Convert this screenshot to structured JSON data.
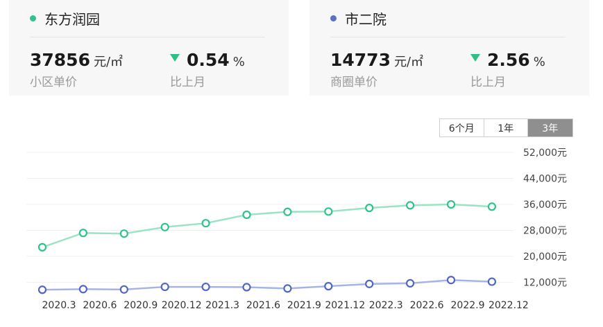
{
  "cards": [
    {
      "name": "东方润园",
      "dot_color": "#2fc28a",
      "price": "37856",
      "price_unit": "元/㎡",
      "price_label": "小区单价",
      "change": "0.54",
      "change_unit": "%",
      "change_label": "比上月"
    },
    {
      "name": "市二院",
      "dot_color": "#5b6fc4",
      "price": "14773",
      "price_unit": "元/㎡",
      "price_label": "商圈单价",
      "change": "2.56",
      "change_unit": "%",
      "change_label": "比上月"
    }
  ],
  "range_buttons": [
    {
      "label": "6个月",
      "active": false
    },
    {
      "label": "1年",
      "active": false
    },
    {
      "label": "3年",
      "active": true
    }
  ],
  "chart_data": {
    "type": "line",
    "x": [
      "2020.3",
      "2020.6",
      "2020.9",
      "2020.12",
      "2021.3",
      "2021.6",
      "2021.9",
      "2021.12",
      "2022.3",
      "2022.6",
      "2022.9",
      "2022.12"
    ],
    "yticks": [
      "12,000元",
      "20,000元",
      "28,000元",
      "36,000元",
      "44,000元",
      "52,000元"
    ],
    "ylim": [
      4000,
      52000
    ],
    "grid": true,
    "series": [
      {
        "name": "东方润园",
        "color": "#2fc28a",
        "line_color": "#9be3c4",
        "values": [
          22800,
          27200,
          27000,
          29000,
          30200,
          32800,
          33700,
          33800,
          34900,
          35700,
          36000,
          35300
        ]
      },
      {
        "name": "市二院",
        "color": "#5165c4",
        "line_color": "#a6b3e4",
        "values": [
          9700,
          9900,
          9800,
          10600,
          10600,
          10500,
          10100,
          10800,
          11500,
          11700,
          12700,
          12200
        ]
      }
    ]
  }
}
